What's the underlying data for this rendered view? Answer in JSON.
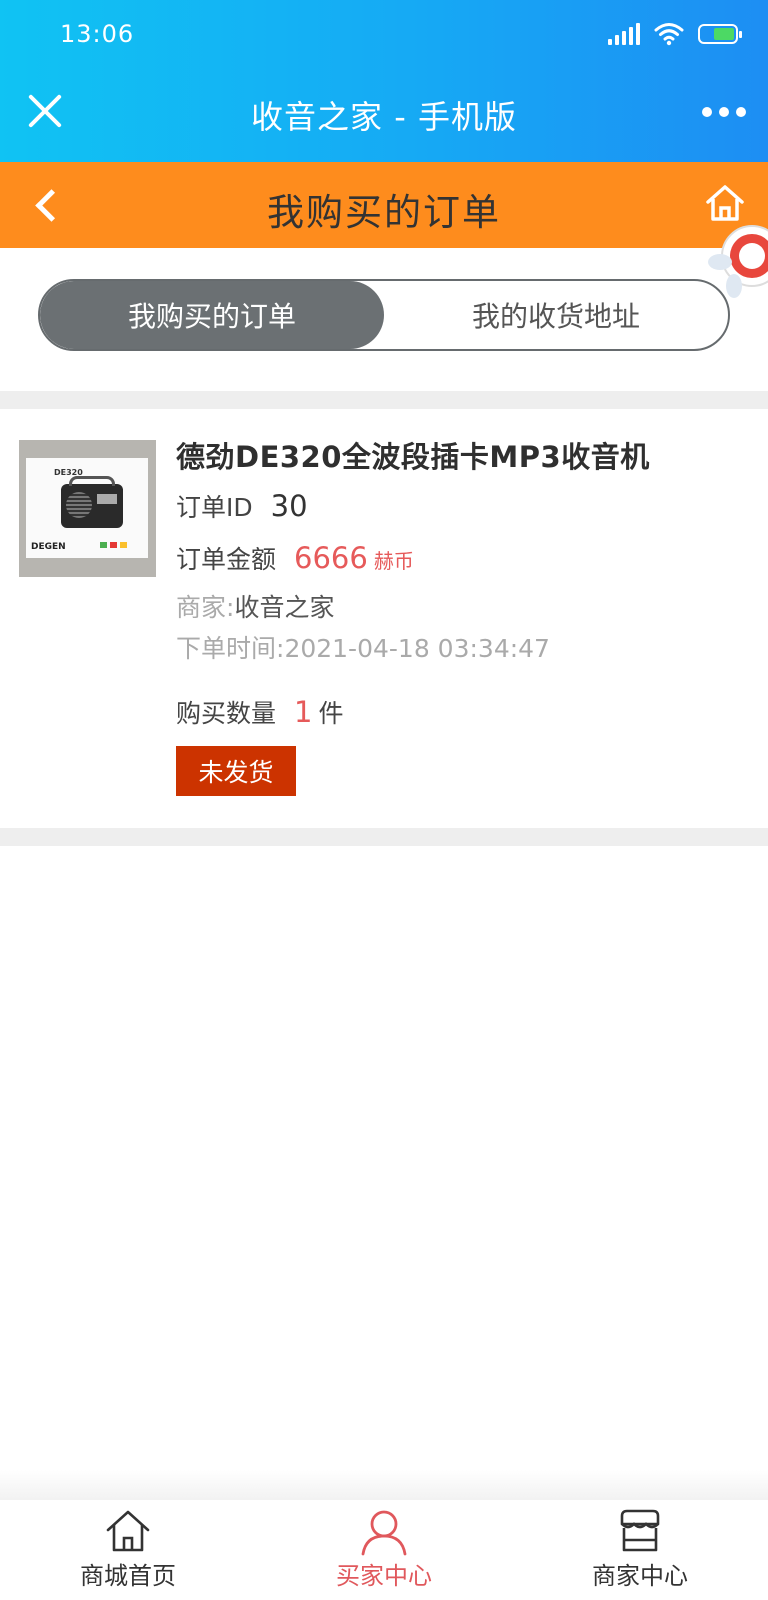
{
  "status_bar": {
    "time": "13:06"
  },
  "app_bar": {
    "title": "收音之家 - 手机版"
  },
  "header": {
    "title": "我购买的订单"
  },
  "tabs": [
    {
      "label": "我购买的订单",
      "active": true
    },
    {
      "label": "我的收货地址",
      "active": false
    }
  ],
  "order": {
    "product_name": "德劲DE320全波段插卡MP3收音机",
    "thumb": {
      "model_text": "DE320",
      "brand_text": "DEGEN"
    },
    "id_label": "订单ID",
    "id_value": "30",
    "amount_label": "订单金额",
    "amount_value": "6666",
    "amount_currency": "赫币",
    "merchant_label": "商家:",
    "merchant_value": "收音之家",
    "time_label": "下单时间:",
    "time_value": "2021-04-18 03:34:47",
    "quantity_label": "购买数量",
    "quantity_value": "1",
    "quantity_unit": "件",
    "status": "未发货"
  },
  "bottom_nav": [
    {
      "label": "商城首页",
      "icon": "home-icon",
      "active": false
    },
    {
      "label": "买家中心",
      "icon": "user-icon",
      "active": true
    },
    {
      "label": "商家中心",
      "icon": "store-icon",
      "active": false
    }
  ],
  "colors": {
    "app_bar": "#16a9f4",
    "header": "#fe8c1d",
    "price": "#e65a5a",
    "status_badge": "#cc3300",
    "nav_active": "#e0585c"
  }
}
